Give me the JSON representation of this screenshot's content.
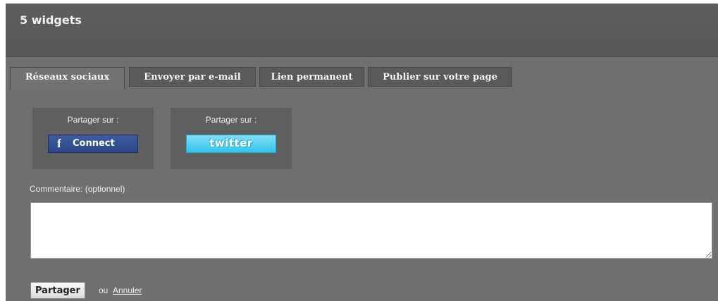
{
  "header": {
    "title": "5 widgets"
  },
  "tabs": [
    {
      "label": "Réseaux sociaux",
      "active": true
    },
    {
      "label": "Envoyer par e-mail",
      "active": false
    },
    {
      "label": "Lien permanent",
      "active": false
    },
    {
      "label": "Publier sur votre page",
      "active": false
    }
  ],
  "share": {
    "facebook": {
      "label": "Partager sur :",
      "icon": "facebook-icon",
      "button_text": "Connect"
    },
    "twitter": {
      "label": "Partager sur :",
      "button_text": "twitter"
    }
  },
  "comment": {
    "label": "Commentaire: (optionnel)",
    "value": ""
  },
  "actions": {
    "submit_label": "Partager",
    "or_text": "ou",
    "cancel_label": "Annuler"
  },
  "colors": {
    "panel_background": "#6f6f6f",
    "header_background": "#5b5b5b",
    "facebook_blue": "#3b5998",
    "twitter_blue": "#4ccaf0"
  }
}
